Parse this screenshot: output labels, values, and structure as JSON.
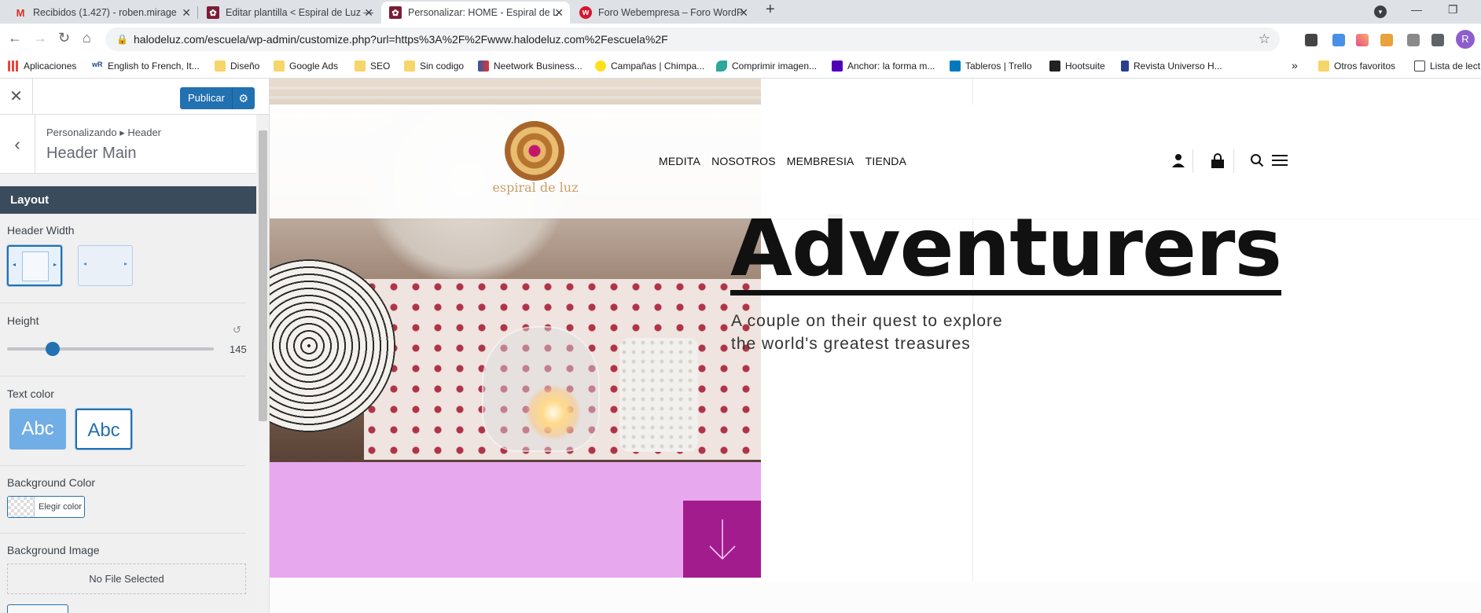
{
  "browser": {
    "tabs": [
      {
        "title": "Recibidos (1.427) - roben.mirage",
        "icon": "gmail-icon",
        "color": "#d93025"
      },
      {
        "title": "Editar plantilla < Espiral de Luz —",
        "icon": "site-icon",
        "color": "#7b1d36"
      },
      {
        "title": "Personalizar: HOME - Espiral de L",
        "icon": "site-icon",
        "color": "#7b1d36"
      },
      {
        "title": "Foro Webempresa – Foro WordP",
        "icon": "webempresa-icon",
        "color": "#d6142d"
      }
    ],
    "url": "halodeluz.com/escuela/wp-admin/customize.php?url=https%3A%2F%2Fwww.halodeluz.com%2Fescuela%2F",
    "bookmarks": [
      {
        "label": "Aplicaciones",
        "icon": "apps-grid-icon"
      },
      {
        "label": "English to French, It...",
        "icon": "wordreference-icon"
      },
      {
        "label": "Diseño",
        "icon": "folder-icon"
      },
      {
        "label": "Google Ads",
        "icon": "folder-icon"
      },
      {
        "label": "SEO",
        "icon": "folder-icon"
      },
      {
        "label": "Sin codigo",
        "icon": "folder-icon"
      },
      {
        "label": "Neetwork Business...",
        "icon": "neetwork-icon"
      },
      {
        "label": "Campañas | Chimpa...",
        "icon": "mailchimp-icon"
      },
      {
        "label": "Comprimir imagen...",
        "icon": "leaf-icon"
      },
      {
        "label": "Anchor: la forma m...",
        "icon": "anchor-icon"
      },
      {
        "label": "Tableros | Trello",
        "icon": "trello-icon"
      },
      {
        "label": "Hootsuite",
        "icon": "hootsuite-icon"
      },
      {
        "label": "Revista Universo H...",
        "icon": "page-icon"
      },
      {
        "label": "Otros favoritos",
        "icon": "folder-icon"
      },
      {
        "label": "Lista de lect",
        "icon": "reading-list-icon"
      }
    ],
    "more_bookmarks": "»",
    "avatar_letter": "R"
  },
  "customizer": {
    "publish_label": "Publicar",
    "breadcrumb": "Personalizando ▸ Header",
    "section_title": "Header Main",
    "layout_heading": "Layout",
    "header_width_label": "Header Width",
    "height_label": "Height",
    "height_value": "145",
    "height_fraction": 0.22,
    "text_color_label": "Text color",
    "text_color_options": [
      "Abc",
      "Abc"
    ],
    "bg_color_label": "Background Color",
    "choose_color_label": "Elegir color",
    "bg_image_label": "Background Image",
    "no_file_label": "No File Selected"
  },
  "preview": {
    "menu": [
      "MEDITA",
      "NOSOTROS",
      "MEMBRESIA",
      "TIENDA"
    ],
    "logo_text": "espiral de luz",
    "hero_title": "Adventurers",
    "hero_subtitle": "A couple on their quest to explore the world's greatest treasures"
  }
}
